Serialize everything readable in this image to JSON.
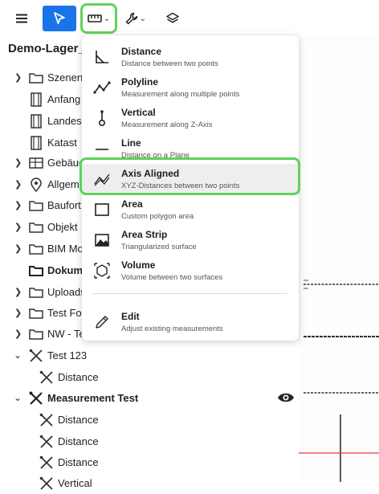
{
  "toolbar": {
    "menu_icon": "hamburger-menu-icon",
    "select_icon": "cursor-arrow-icon",
    "measure_icon": "ruler-icon",
    "tools_icon": "wrench-icon",
    "layers_icon": "layers-icon",
    "accent_color": "#1a73e8",
    "highlight_color": "#5fd35a"
  },
  "sidebar": {
    "title": "Demo-Lager_u",
    "items": [
      {
        "label": "Szenen",
        "icon": "folder-icon"
      },
      {
        "label": "Anfang",
        "icon": "film-icon"
      },
      {
        "label": "Landes",
        "icon": "film-icon"
      },
      {
        "label": "Katast",
        "icon": "film-icon"
      },
      {
        "label": "Gebäuc",
        "icon": "building-icon"
      },
      {
        "label": "Allgem",
        "icon": "location-pin-icon"
      },
      {
        "label": "Baufort",
        "icon": "folder-icon"
      },
      {
        "label": "Objekt",
        "icon": "folder-icon"
      },
      {
        "label": "BIM Mo",
        "icon": "folder-icon"
      },
      {
        "label": "Dokum",
        "icon": "folder-icon"
      },
      {
        "label": "Uploads",
        "icon": "folder-icon"
      },
      {
        "label": "Test Fo",
        "icon": "folder-icon"
      },
      {
        "label": "NW - Te",
        "icon": "folder-icon"
      },
      {
        "label": "Test 123",
        "icon": "measurement-icon"
      },
      {
        "label": "Distance",
        "icon": "measurement-icon"
      },
      {
        "label": "Measurement Test",
        "icon": "measurement-icon"
      },
      {
        "label": "Distance",
        "icon": "measurement-icon"
      },
      {
        "label": "Distance",
        "icon": "measurement-icon"
      },
      {
        "label": "Distance",
        "icon": "measurement-icon"
      },
      {
        "label": "Vertical",
        "icon": "measurement-icon"
      }
    ]
  },
  "dropdown": {
    "items": [
      {
        "title": "Distance",
        "subtitle": "Distance between two points",
        "icon": "distance-icon"
      },
      {
        "title": "Polyline",
        "subtitle": "Measurement along multiple points",
        "icon": "polyline-icon"
      },
      {
        "title": "Vertical",
        "subtitle": "Measurement along Z-Axis",
        "icon": "vertical-icon"
      },
      {
        "title": "Line",
        "subtitle": "Distance on a Plane",
        "icon": "line-icon"
      },
      {
        "title": "Axis Aligned",
        "subtitle": "XYZ-Distances between two points",
        "icon": "axis-aligned-icon"
      },
      {
        "title": "Area",
        "subtitle": "Custom polygon area",
        "icon": "area-icon"
      },
      {
        "title": "Area Strip",
        "subtitle": "Triangularized surface",
        "icon": "area-strip-icon"
      },
      {
        "title": "Volume",
        "subtitle": "Volume between two surfaces",
        "icon": "volume-icon"
      },
      {
        "title": "Edit",
        "subtitle": "Adjust existing measurements",
        "icon": "pencil-icon"
      }
    ]
  }
}
